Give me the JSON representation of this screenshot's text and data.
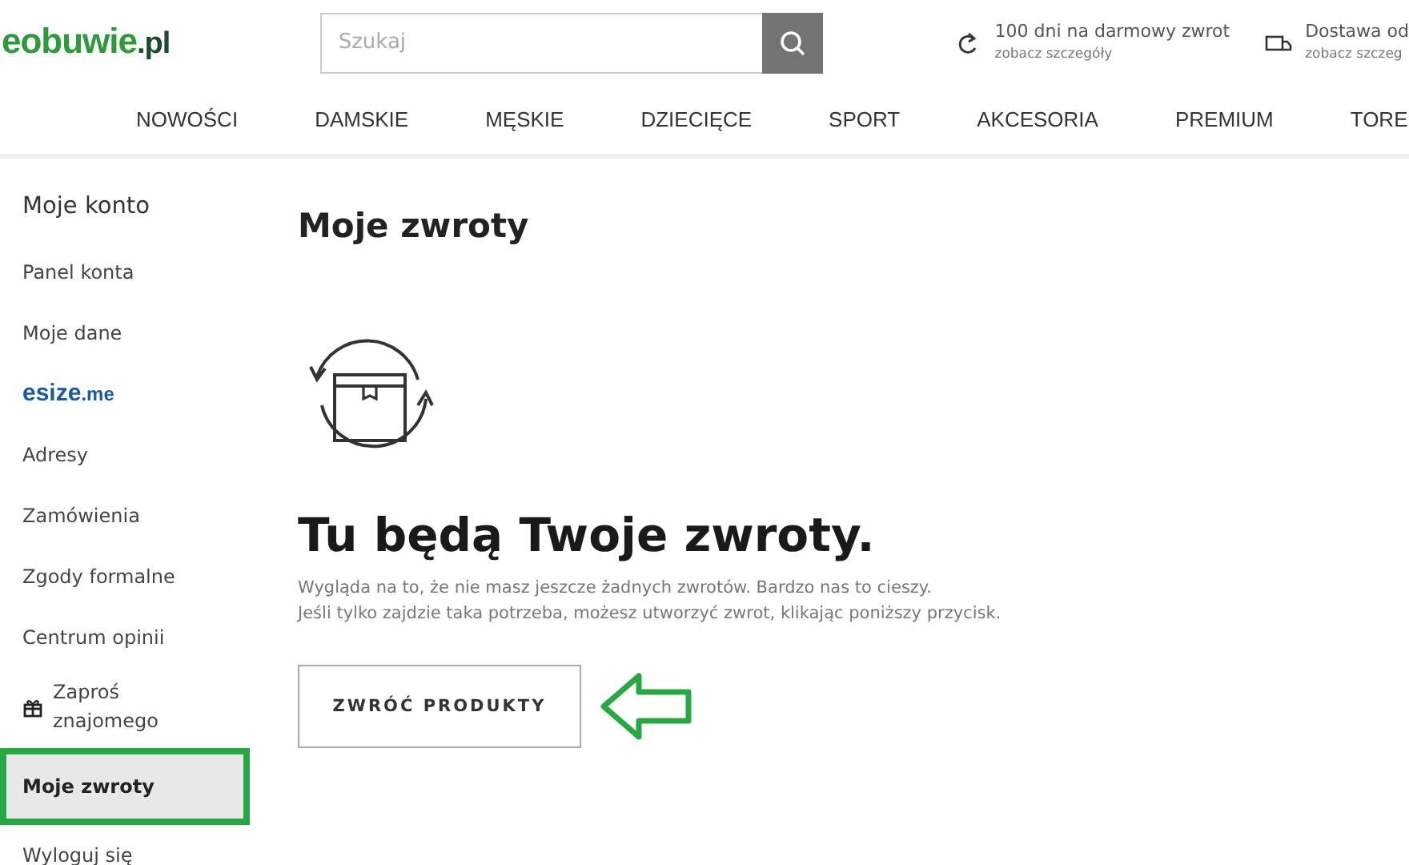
{
  "header": {
    "logo": {
      "name": "eobuwie",
      "suffix": ".pl"
    },
    "search": {
      "placeholder": "Szukaj"
    },
    "info": [
      {
        "kind": "return",
        "title": "100 dni na darmowy zwrot",
        "link": "zobacz szczegóły"
      },
      {
        "kind": "delivery",
        "title": "Dostawa od",
        "link": "zobacz szczeg"
      }
    ]
  },
  "nav": [
    "NOWOŚCI",
    "DAMSKIE",
    "MĘSKIE",
    "DZIECIĘCE",
    "SPORT",
    "AKCESORIA",
    "PREMIUM",
    "TORE"
  ],
  "sidebar": {
    "title": "Moje konto",
    "items": [
      {
        "kind": "link",
        "label": "Panel konta",
        "selected": false
      },
      {
        "kind": "link",
        "label": "Moje dane",
        "selected": false
      },
      {
        "kind": "brand",
        "label": "esize",
        "suffix": ".me",
        "selected": false
      },
      {
        "kind": "link",
        "label": "Adresy",
        "selected": false
      },
      {
        "kind": "link",
        "label": "Zamówienia",
        "selected": false
      },
      {
        "kind": "link",
        "label": "Zgody formalne",
        "selected": false
      },
      {
        "kind": "link",
        "label": "Centrum opinii",
        "selected": false
      },
      {
        "kind": "gift",
        "label": "Zaproś znajomego",
        "selected": false
      },
      {
        "kind": "link",
        "label": "Moje zwroty",
        "selected": true
      },
      {
        "kind": "link",
        "label": "Wyloguj się",
        "selected": false
      }
    ]
  },
  "main": {
    "title": "Moje zwroty",
    "heading": "Tu będą Twoje zwroty.",
    "text": [
      "Wygląda na to, że nie masz jeszcze żadnych zwrotów. Bardzo nas to cieszy.",
      "Jeśli tylko zajdzie taka potrzeba, możesz utworzyć zwrot, klikając poniższy przycisk."
    ],
    "button": "ZWRÓĆ PRODUKTY"
  }
}
